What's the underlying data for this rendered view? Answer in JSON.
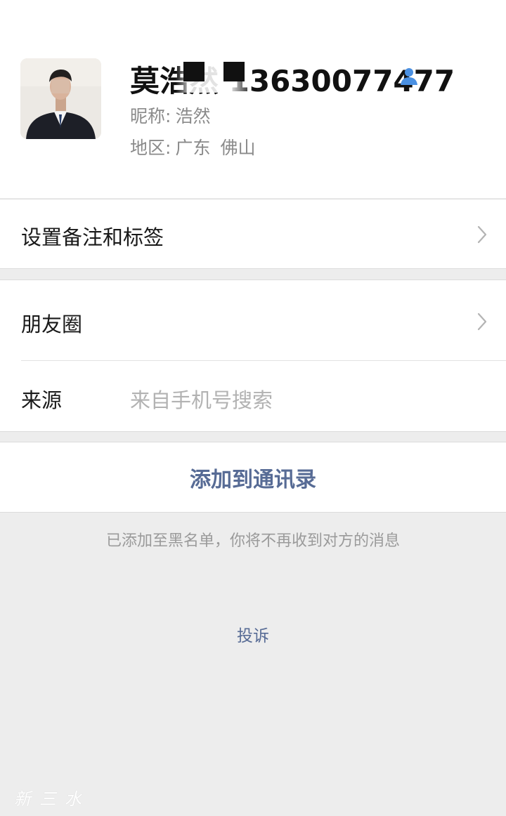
{
  "profile": {
    "name": "莫浩然 13630077477",
    "nickname_label": "昵称:",
    "nickname_value": "浩然",
    "region_label": "地区:",
    "region_province": "广东",
    "region_city": "佛山",
    "contact_icon": "person-icon",
    "accent_color": "#4a90e2"
  },
  "cells": {
    "remark_label": "设置备注和标签",
    "moments_label": "朋友圈",
    "source_label": "来源",
    "source_value": "来自手机号搜索"
  },
  "actions": {
    "add_contact_label": "添加到通讯录",
    "report_label": "投诉"
  },
  "notice": "已添加至黑名单，你将不再收到对方的消息",
  "watermark": "新三水",
  "colors": {
    "link": "#576b95",
    "background": "#ededed"
  }
}
